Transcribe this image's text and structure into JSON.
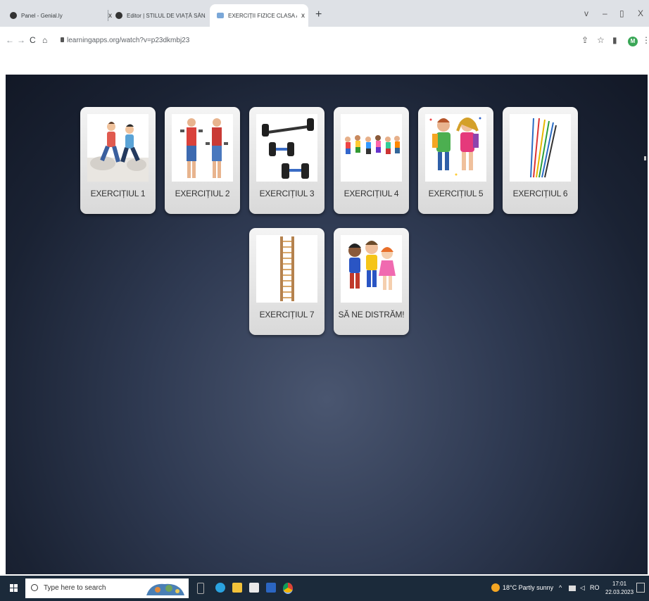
{
  "browser": {
    "tabs": [
      {
        "title": "Panel - Genial.ly",
        "close": "x"
      },
      {
        "title": "Editor | STILUL DE VIAȚĂ SĂNĂT",
        "close": "x"
      },
      {
        "title": "EXERCIȚII FIZICE CLASA A V-A D",
        "close": "x"
      }
    ],
    "new_tab": "+",
    "controls": {
      "dropdown": "v",
      "minimize": "–",
      "maximize": "▯",
      "close": "X"
    },
    "nav": {
      "back": "←",
      "forward": "→",
      "reload": "C",
      "home": "⌂"
    },
    "url": "learningapps.org/watch?v=p23dkmbj23",
    "toolbar_right": {
      "share": "⇪",
      "bookmark": "☆",
      "sidepanel": "▮",
      "profile": "M",
      "menu": "⋮"
    }
  },
  "cards": [
    {
      "label": "EXERCIȚIUL 1",
      "icon": "runners-image"
    },
    {
      "label": "EXERCIȚIUL 2",
      "icon": "dumbbell-men-image"
    },
    {
      "label": "EXERCIȚIUL 3",
      "icon": "dumbbells-image"
    },
    {
      "label": "EXERCIȚIUL 4",
      "icon": "kids-running-image"
    },
    {
      "label": "EXERCIȚIUL 5",
      "icon": "schoolkids-image"
    },
    {
      "label": "EXERCIȚIUL 6",
      "icon": "gym-sticks-image"
    },
    {
      "label": "EXERCIȚIUL 7",
      "icon": "wall-bars-image"
    },
    {
      "label": "SĂ NE DISTRĂM!",
      "icon": "happy-kids-image"
    }
  ],
  "taskbar": {
    "search_placeholder": "Type here to search",
    "weather": "18°C Partly sunny",
    "language": "RO",
    "time": "17:01",
    "date": "22.03.2023"
  },
  "colors": {
    "page_bg": "#1a2233",
    "card_bg": "#e6e6e6",
    "taskbar": "#1b2a3a"
  }
}
